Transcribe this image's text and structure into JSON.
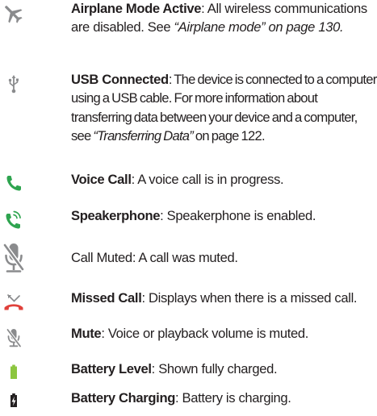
{
  "entries": [
    {
      "icon": "airplane-icon",
      "term": "Airplane Mode Active",
      "text_before_ref": ": All wireless communications are disabled. See ",
      "ref": "“Airplane mode” on page 130.",
      "text_after_ref": ""
    },
    {
      "icon": "usb-icon",
      "term": "USB Connected",
      "text_before_ref": ": The device is connected to a computer using a USB cable. For more information about transferring data between your device and a computer, see ",
      "ref": "“Transferring Data”",
      "text_after_ref": " on page 122."
    },
    {
      "icon": "phone-call-icon",
      "term": "Voice Call",
      "text_before_ref": ": A voice call is in progress.",
      "ref": "",
      "text_after_ref": ""
    },
    {
      "icon": "speakerphone-icon",
      "term": "Speakerphone",
      "text_before_ref": ": Speakerphone is enabled.",
      "ref": "",
      "text_after_ref": ""
    },
    {
      "icon": "microphone-muted-icon",
      "term": "",
      "text_before_ref": "Call Muted: A call was muted.",
      "ref": "",
      "text_after_ref": ""
    },
    {
      "icon": "missed-call-icon",
      "term": "Missed Call",
      "text_before_ref": ": Displays when there is a missed call.",
      "ref": "",
      "text_after_ref": ""
    },
    {
      "icon": "mute-icon",
      "term": "Mute",
      "text_before_ref": ": Voice or playback volume is muted.",
      "ref": "",
      "text_after_ref": ""
    },
    {
      "icon": "battery-full-icon",
      "term": "Battery Level",
      "text_before_ref": ": Shown fully charged.",
      "ref": "",
      "text_after_ref": ""
    },
    {
      "icon": "battery-charging-icon",
      "term": "Battery Charging",
      "text_before_ref": ": Battery is charging.",
      "ref": "",
      "text_after_ref": ""
    }
  ],
  "colors": {
    "text": "#231f20",
    "icon_gray": "#8a8b8d",
    "call_green": "#2ea44f",
    "missed_red": "#e0413b",
    "battery_green": "#8cc63f"
  }
}
